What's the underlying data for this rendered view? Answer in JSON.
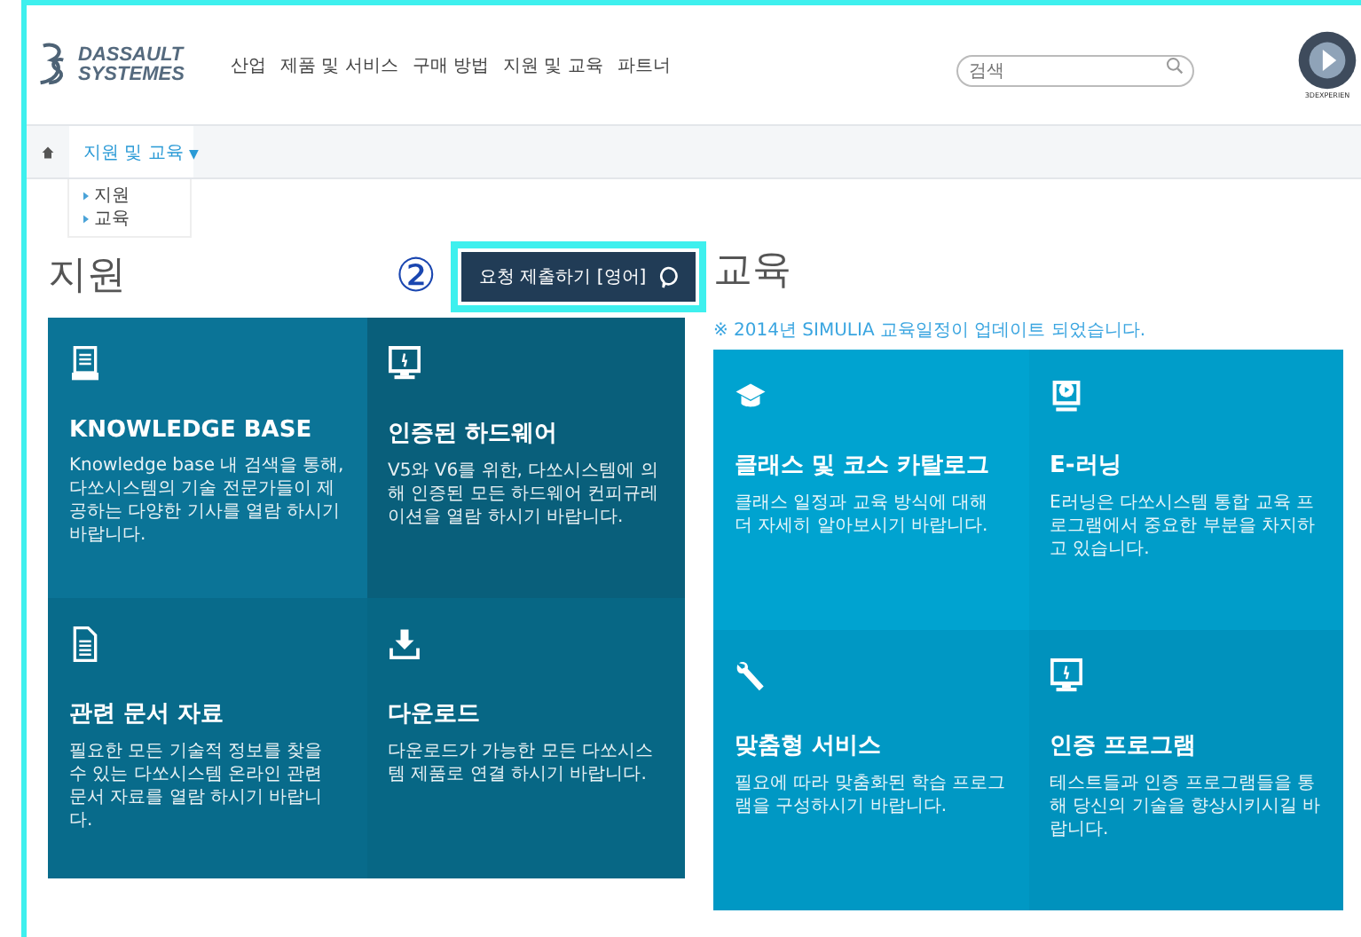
{
  "header": {
    "logo": {
      "line1": "DASSAULT",
      "line2": "SYSTEMES"
    },
    "nav": [
      "산업",
      "제품 및 서비스",
      "구매 방법",
      "지원 및 교육",
      "파트너"
    ],
    "search": {
      "placeholder": "검색"
    },
    "compass": {
      "caption": "3DEXPERIEN"
    }
  },
  "breadcrumb": {
    "items": [
      {
        "label": "지원 및 교육",
        "caret": "▼",
        "selected": true
      }
    ],
    "submenu": [
      "지원",
      "교육"
    ]
  },
  "support": {
    "title": "지원",
    "annotation": "②",
    "button": "요청 제출하기 [영어]",
    "tiles": [
      {
        "kind": "book",
        "title": "KNOWLEDGE BASE",
        "text": "Knowledge base 내 검색을 통해, 다쏘시스템의 기술 전문가들이 제공하는 다양한 기사를 열람 하시기 바랍니다.",
        "color": "#0b7497"
      },
      {
        "kind": "monitor",
        "title": "인증된 하드웨어",
        "text": "V5와 V6를 위한, 다쏘시스템에 의해 인증된 모든 하드웨어 컨피규레이션을 열람 하시기 바랍니다.",
        "color": "#095f7b"
      },
      {
        "kind": "document",
        "title": "관련 문서 자료",
        "text": "필요한 모든 기술적 정보를 찾을 수 있는 다쏘시스템 온라인 관련 문서 자료를 열람 하시기 바랍니다.",
        "color": "#086b8b"
      },
      {
        "kind": "download",
        "title": "다운로드",
        "text": "다운로드가 가능한 모든 다쏘시스템 제품로 연결 하시기 바랍니다.",
        "color": "#076785"
      }
    ]
  },
  "education": {
    "title": "교육",
    "note": "※ 2014년 SIMULIA 교육일정이 업데이트 되었습니다.",
    "tiles": [
      {
        "kind": "cap",
        "title": "클래스 및 코스 카탈로그",
        "text": "클래스 일정과 교육 방식에 대해 더 자세히 알아보시기 바랍니다.",
        "color": "#00a3d0"
      },
      {
        "kind": "video",
        "title": "E-러닝",
        "text": "E러닝은 다쏘시스템 통합 교육 프로그램에서 중요한 부분을 차지하고 있습니다.",
        "color": "#009dc9"
      },
      {
        "kind": "wrench",
        "title": "맞춤형 서비스",
        "text": "필요에 따라 맞춤화된 학습 프로그램을 구성하시기 바랍니다.",
        "color": "#0098c4"
      },
      {
        "kind": "monitor",
        "title": "인증 프로그램",
        "text": "테스트들과 인증 프로그램들을 통해 당신의 기술을 향상시키시길 바랍니다.",
        "color": "#0092bd"
      }
    ]
  }
}
